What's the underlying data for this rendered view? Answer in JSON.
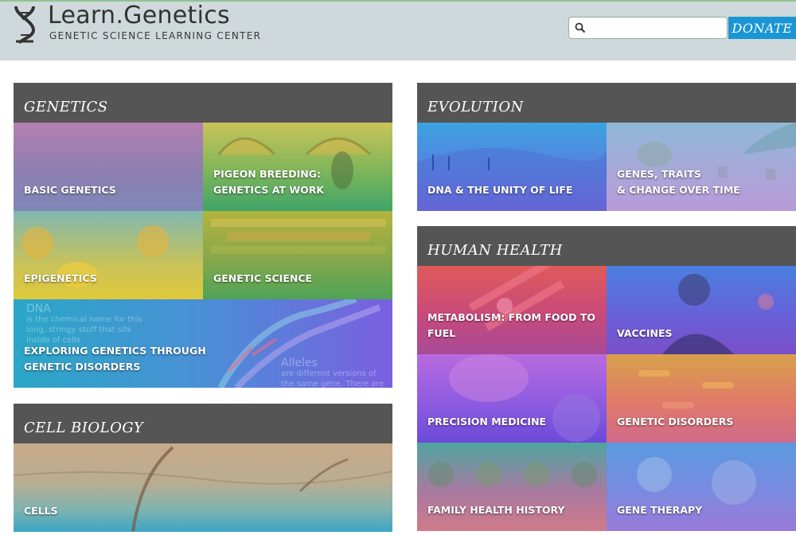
{
  "header": {
    "site_title": "Learn.Genetics",
    "site_subtitle": "GENETIC SCIENCE LEARNING CENTER",
    "search_placeholder": "",
    "donate_label": "DONATE"
  },
  "sections": {
    "genetics": {
      "title": "GENETICS",
      "tiles": {
        "basic_genetics": "BASIC GENETICS",
        "pigeon_breeding": "PIGEON BREEDING:\nGENETICS AT WORK",
        "epigenetics": "EPIGENETICS",
        "genetic_science": "GENETIC SCIENCE",
        "exploring_genetics": "EXPLORING GENETICS THROUGH\nGENETIC DISORDERS"
      },
      "exploring_overlay": {
        "dna_title": "DNA",
        "dna_text": "is the chemical name for this long, stringy stuff that sits inside of cells",
        "alleles_title": "Alleles",
        "alleles_text": "are different versions of the same gene. There are"
      }
    },
    "cell_biology": {
      "title": "CELL BIOLOGY",
      "tiles": {
        "cells": "CELLS"
      }
    },
    "evolution": {
      "title": "EVOLUTION",
      "tiles": {
        "dna_unity": "DNA & THE UNITY OF LIFE",
        "genes_traits": "GENES, TRAITS\n& CHANGE OVER TIME"
      }
    },
    "human_health": {
      "title": "HUMAN HEALTH",
      "tiles": {
        "metabolism": "METABOLISM: FROM FOOD TO FUEL",
        "vaccines": "VACCINES",
        "precision_medicine": "PRECISION MEDICINE",
        "genetic_disorders": "GENETIC DISORDERS",
        "family_health_history": "FAMILY HEALTH HISTORY",
        "gene_therapy": "GENE THERAPY"
      }
    }
  },
  "icons": [
    "dna-logo-icon",
    "search-icon"
  ]
}
